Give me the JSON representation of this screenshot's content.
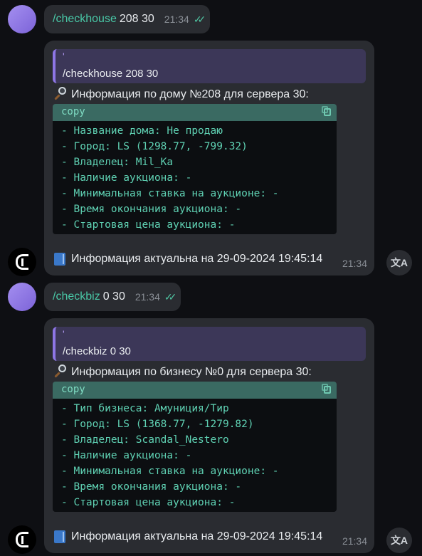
{
  "messages": [
    {
      "command": "/checkhouse",
      "args": "208 30",
      "time": "21:34",
      "reply": {
        "quote_mark": "'",
        "quote_text": "/checkhouse 208 30",
        "info": "Информация по дому №208 для сервера 30:",
        "code_header": "copy",
        "code_lines": [
          "- Название дома: Не продаю",
          "- Город: LS (1298.77, -799.32)",
          "- Владелец: Mil_Ka",
          "- Наличие аукциона: -",
          "- Минимальная ставка на аукционе: -",
          "- Время окончания аукциона: -",
          "- Стартовая цена аукциона: -"
        ],
        "footer": "Информация актуальна на 29-09-2024 19:45:14",
        "time": "21:34"
      }
    },
    {
      "command": "/checkbiz",
      "args": "0 30",
      "time": "21:34",
      "reply": {
        "quote_mark": "'",
        "quote_text": "/checkbiz 0 30",
        "info": "Информация по бизнесу №0 для сервера 30:",
        "code_header": "copy",
        "code_lines": [
          "- Тип бизнеса: Амуниция/Тир",
          "- Город: LS (1368.77, -1279.82)",
          "- Владелец: Scandal_Nestero",
          "- Наличие аукциона: -",
          "- Минимальная ставка на аукционе: -",
          "- Время окончания аукциона: -",
          "- Стартовая цена аукциона: -"
        ],
        "footer": "Информация актуальна на 29-09-2024 19:45:14",
        "time": "21:34"
      }
    }
  ],
  "icons": {
    "read_ticks": "double-check-icon",
    "search": "magnifier-icon",
    "book": "blue-book-icon",
    "translate": "translate-icon",
    "copy": "copy-icon"
  },
  "colors": {
    "background": "#0e0f13",
    "bubble": "#2a2c31",
    "command": "#49c7a6",
    "quote_bg": "#3c3758",
    "quote_bar": "#8e76e6",
    "code_head": "#3a6a62",
    "code_text": "#5fd1b3"
  },
  "translate_label": "文A"
}
